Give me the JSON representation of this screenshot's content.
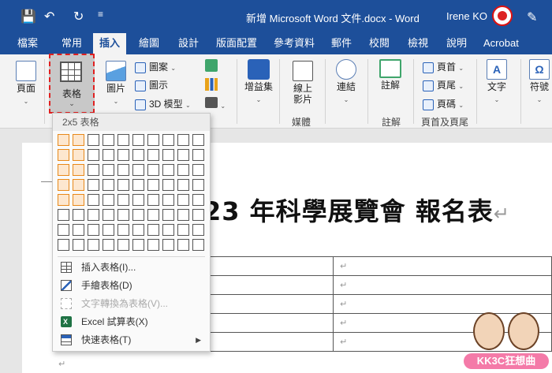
{
  "titlebar": {
    "title": "新增 Microsoft Word 文件.docx - Word",
    "user": "Irene KO",
    "icons": [
      "save-icon",
      "undo-icon",
      "redo-icon",
      "qat-more-icon",
      "pen-icon"
    ]
  },
  "tabs": [
    "檔案",
    "常用",
    "插入",
    "繪圖",
    "設計",
    "版面配置",
    "參考資料",
    "郵件",
    "校閱",
    "檢視",
    "說明",
    "Acrobat"
  ],
  "active_tab": "插入",
  "ribbon": {
    "page": "頁面",
    "table": "表格",
    "picture": "圖片",
    "shapes": "圖案",
    "icons": "圖示",
    "model3d": "3D 模型",
    "addins": "增益集",
    "online_video": "線上影片",
    "media_group": "媒體",
    "links": "連結",
    "comment": "註解",
    "comment_group": "註解",
    "header": "頁首",
    "footer": "頁尾",
    "page_number": "頁碼",
    "header_footer_group": "頁首及頁尾",
    "text": "文字",
    "symbols": "符號"
  },
  "dropdown": {
    "header": "2x5 表格",
    "grid_cols": 10,
    "grid_rows": 8,
    "selected_cols": 2,
    "selected_rows": 5,
    "items": [
      {
        "label": "插入表格(I)...",
        "icon": "insert-table-icon",
        "enabled": true
      },
      {
        "label": "手繪表格(D)",
        "icon": "draw-table-icon",
        "enabled": true
      },
      {
        "label": "文字轉換為表格(V)...",
        "icon": "convert-text-icon",
        "enabled": false
      },
      {
        "label": "Excel 試算表(X)",
        "icon": "excel-icon",
        "enabled": true
      },
      {
        "label": "快速表格(T)",
        "icon": "quick-table-icon",
        "enabled": true
      }
    ]
  },
  "document": {
    "title": "23 年科學展覽會  報名表",
    "paragraph_mark": "↵"
  },
  "watermark": {
    "text": "KK3C狂想曲"
  }
}
